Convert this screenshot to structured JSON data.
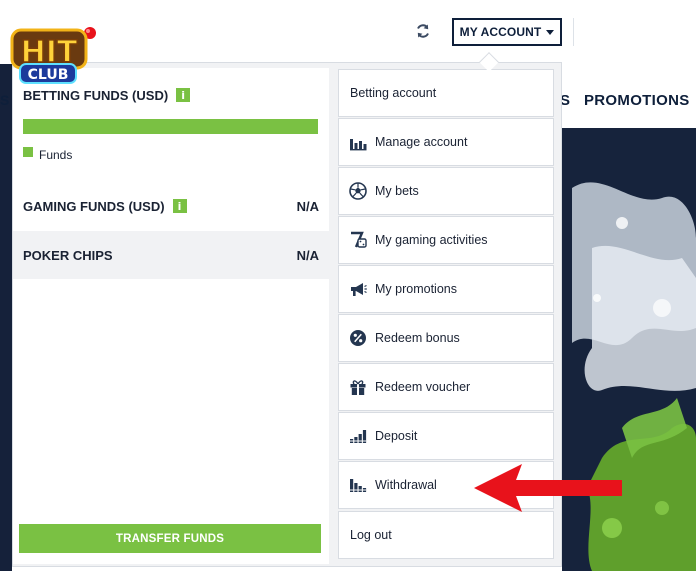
{
  "header": {
    "account_label": "MY ACCOUNT",
    "promotions_label": "PROMOTIONS",
    "left_cut_letter": "S"
  },
  "logo": {
    "line1": "HIT",
    "line2": "CLUB"
  },
  "funds": {
    "betting": {
      "title": "BETTING FUNDS (USD)",
      "info": "i",
      "bar_fill": 1.0,
      "legend": "Funds"
    },
    "gaming": {
      "title": "GAMING FUNDS (USD)",
      "info": "i",
      "value": "N/A"
    },
    "poker": {
      "title": "POKER CHIPS",
      "value": "N/A"
    },
    "transfer_label": "TRANSFER FUNDS"
  },
  "menu": {
    "items": [
      {
        "label": "Betting account",
        "icon": ""
      },
      {
        "label": "Manage account",
        "icon": "bars-chart-icon"
      },
      {
        "label": "My bets",
        "icon": "soccer-ball-icon"
      },
      {
        "label": "My gaming activities",
        "icon": "seven-dice-icon"
      },
      {
        "label": "My promotions",
        "icon": "megaphone-icon"
      },
      {
        "label": "Redeem bonus",
        "icon": "percent-badge-icon"
      },
      {
        "label": "Redeem voucher",
        "icon": "gift-icon"
      },
      {
        "label": "Deposit",
        "icon": "coin-stack-up-icon"
      },
      {
        "label": "Withdrawal",
        "icon": "coin-stack-down-icon"
      },
      {
        "label": "Log out",
        "icon": ""
      }
    ]
  },
  "colors": {
    "accent": "#7ac143",
    "navy": "#0e1f3a",
    "arrow": "#e8121b"
  }
}
